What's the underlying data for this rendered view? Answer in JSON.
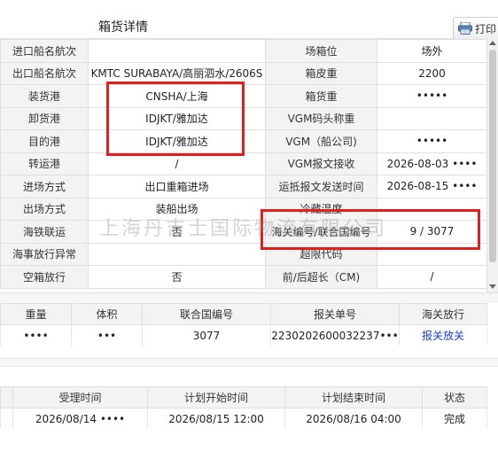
{
  "header": {
    "title": "箱货详情",
    "print_label": "打印"
  },
  "detail_rows": [
    [
      "进口船名航次",
      "",
      "场箱位",
      "场外"
    ],
    [
      "出口船名航次",
      "KMTC SURABAYA/高丽泗水/2606S",
      "箱皮重",
      "2200"
    ],
    [
      "装货港",
      "CNSHA/上海",
      "箱货重",
      "•••••"
    ],
    [
      "卸货港",
      "IDJKT/雅加达",
      "VGM码头称重",
      ""
    ],
    [
      "目的港",
      "IDJKT/雅加达",
      "VGM（船公司)",
      "•••••"
    ],
    [
      "转运港",
      "/",
      "VGM报文接收",
      "2026-08-03 ••••"
    ],
    [
      "进场方式",
      "出口重箱进场",
      "运抵报文发送时间",
      "2026-08-15 ••••"
    ],
    [
      "出场方式",
      "装船出场",
      "冷藏温度",
      ""
    ],
    [
      "海铁联运",
      "否",
      "海关编号/联合国编号",
      "9 / 3077"
    ],
    [
      "海事放行异常",
      "",
      "超限代码",
      ""
    ],
    [
      "空箱放行",
      "否",
      "前/后超长（CM)",
      "/"
    ]
  ],
  "watermark": "上海丹吉士国际物流有限公司",
  "cargo_table": {
    "headers": [
      "重量",
      "体积",
      "联合国编号",
      "报关单号",
      "海关放行"
    ],
    "rows": [
      [
        "••••",
        "•••",
        "3077",
        "2230202600032237•••",
        "报关放关"
      ]
    ]
  },
  "schedule_table": {
    "headers": [
      "",
      "受理时间",
      "计划开始时间",
      "计划结束时间",
      "状态"
    ],
    "rows": [
      [
        "",
        "2026/08/14 ••••",
        "2026/08/15 12:00",
        "2026/08/16 04:00",
        "完成"
      ]
    ]
  },
  "colors": {
    "highlight": "#e0201e",
    "link": "#1a3fd1",
    "label_bg": "#f3f3f3"
  },
  "icons": {
    "print": "printer-icon",
    "scroll_up": "arrow-up-icon",
    "scroll_down": "arrow-down-icon"
  }
}
